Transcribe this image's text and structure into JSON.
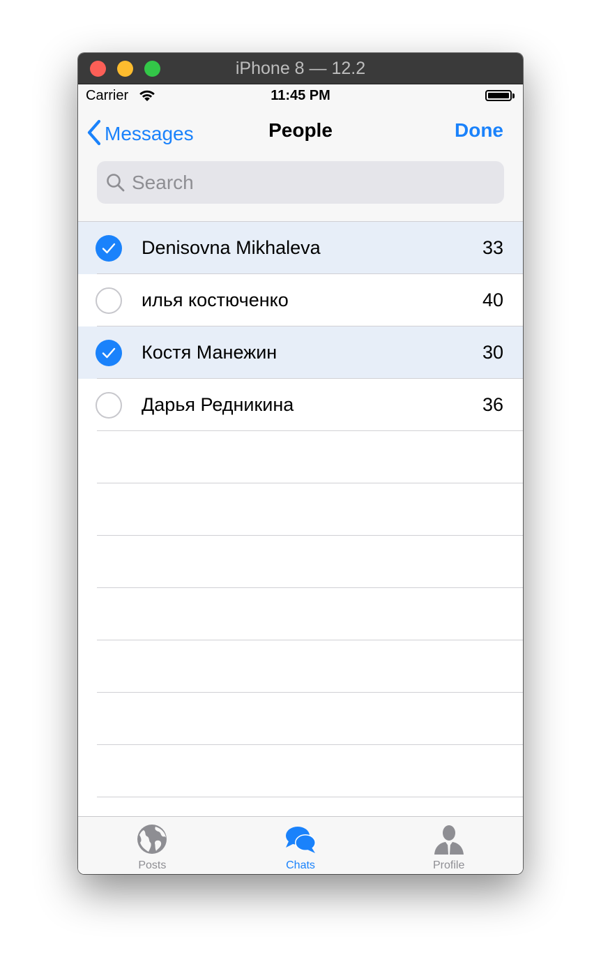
{
  "window": {
    "title": "iPhone 8 — 12.2"
  },
  "status_bar": {
    "carrier": "Carrier",
    "time": "11:45 PM"
  },
  "nav": {
    "back_label": "Messages",
    "title": "People",
    "done_label": "Done"
  },
  "search": {
    "placeholder": "Search",
    "value": ""
  },
  "people": [
    {
      "name": "Denisovna Mikhaleva",
      "count": "33",
      "selected": true
    },
    {
      "name": "илья костюченко",
      "count": "40",
      "selected": false
    },
    {
      "name": "Костя Манежин",
      "count": "30",
      "selected": true
    },
    {
      "name": "Дарья Редникина",
      "count": "36",
      "selected": false
    }
  ],
  "tabs": [
    {
      "label": "Posts",
      "icon": "globe-icon",
      "active": false
    },
    {
      "label": "Chats",
      "icon": "chat-bubbles-icon",
      "active": true
    },
    {
      "label": "Profile",
      "icon": "person-icon",
      "active": false
    }
  ],
  "colors": {
    "accent": "#1a82fb",
    "selected_row": "#e7eef8",
    "inactive_tab": "#8e8e93"
  }
}
